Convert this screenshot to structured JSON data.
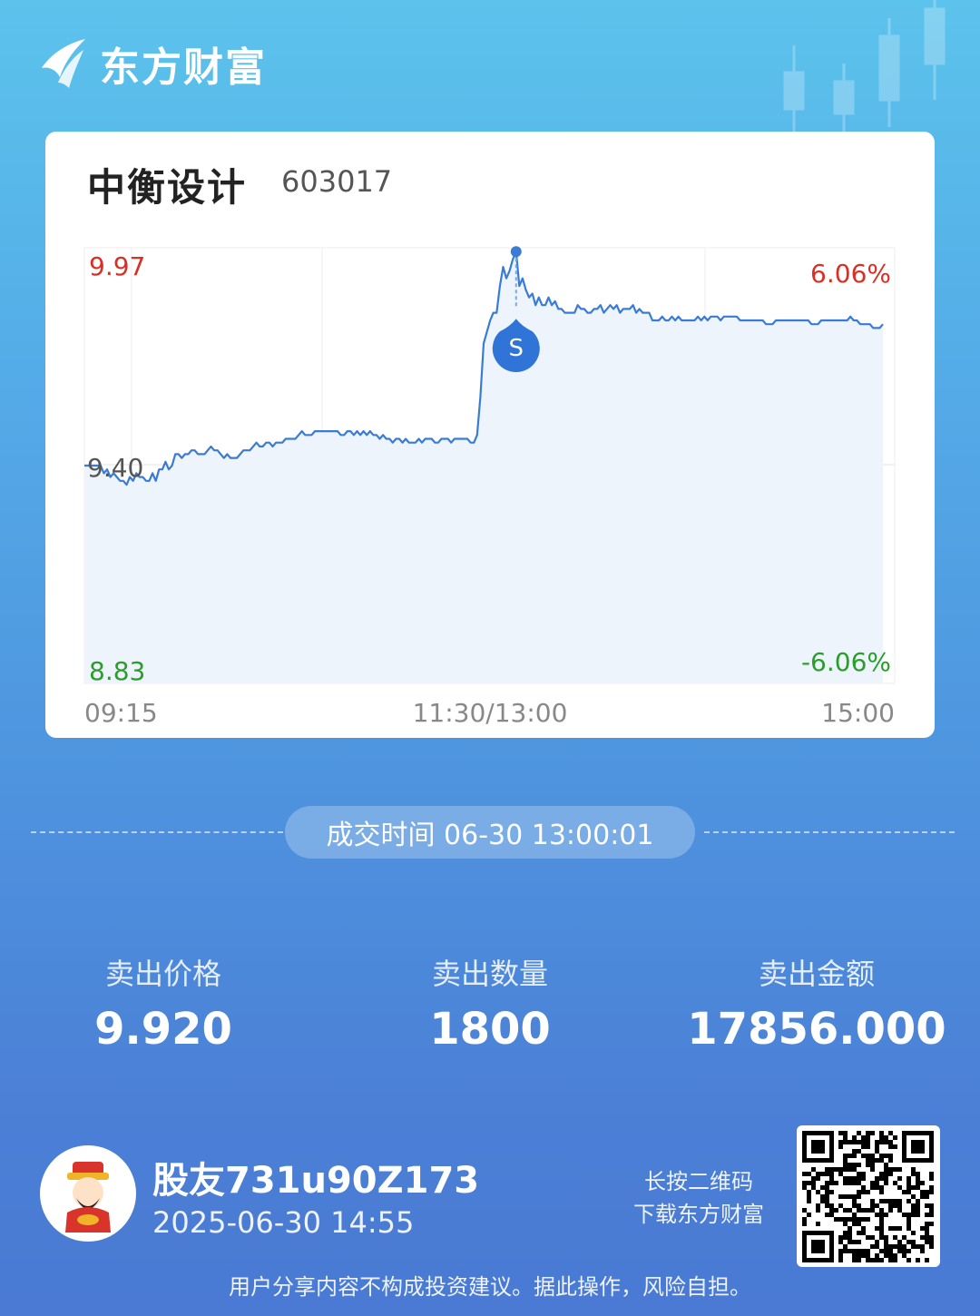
{
  "brand": {
    "name": "东方财富",
    "logo_icon": "eastmoney-logo-icon"
  },
  "stock": {
    "name": "中衡设计",
    "code": "603017"
  },
  "chart_data": {
    "type": "line",
    "x_ticks": [
      "09:15",
      "11:30/13:00",
      "15:00"
    ],
    "y_top": "9.97",
    "y_mid": "9.40",
    "y_bottom": "8.83",
    "pct_top": "6.06%",
    "pct_bottom": "-6.06%",
    "ylim": [
      8.83,
      9.97
    ],
    "ref_price": 9.4,
    "grid": true,
    "colors": {
      "line": "#3a7bd5",
      "up": "#d93026",
      "down": "#2a9d2a",
      "fill": "#eef4fc"
    },
    "marker": {
      "label": "S",
      "price": 9.92,
      "time": "13:00"
    },
    "series": [
      {
        "values": [
          9.4,
          9.4,
          9.4,
          9.4,
          9.4,
          9.4,
          9.38,
          9.39,
          9.37,
          9.38,
          9.37,
          9.36,
          9.36,
          9.35,
          9.37,
          9.36,
          9.38,
          9.37,
          9.37,
          9.36,
          9.36,
          9.38,
          9.36,
          9.39,
          9.39,
          9.41,
          9.39,
          9.4,
          9.43,
          9.43,
          9.42,
          9.43,
          9.43,
          9.44,
          9.44,
          9.43,
          9.43,
          9.43,
          9.44,
          9.45,
          9.44,
          9.44,
          9.43,
          9.42,
          9.43,
          9.42,
          9.42,
          9.42,
          9.43,
          9.44,
          9.44,
          9.44,
          9.45,
          9.46,
          9.45,
          9.45,
          9.46,
          9.46,
          9.45,
          9.46,
          9.46,
          9.46,
          9.47,
          9.47,
          9.47,
          9.47,
          9.48,
          9.49,
          9.48,
          9.48,
          9.48,
          9.49,
          9.49,
          9.49,
          9.49,
          9.49,
          9.49,
          9.49,
          9.49,
          9.48,
          9.48,
          9.49,
          9.49,
          9.48,
          9.49,
          9.48,
          9.49,
          9.48,
          9.49,
          9.48,
          9.48,
          9.47,
          9.48,
          9.47,
          9.47,
          9.46,
          9.47,
          9.47,
          9.46,
          9.47,
          9.46,
          9.46,
          9.46,
          9.47,
          9.46,
          9.47,
          9.47,
          9.47,
          9.46,
          9.46,
          9.47,
          9.47,
          9.47,
          9.46,
          9.47,
          9.47,
          9.47,
          9.47,
          9.47,
          9.46,
          9.46,
          9.48,
          9.58,
          9.72,
          9.75,
          9.78,
          9.8,
          9.8,
          9.87,
          9.92,
          9.89,
          9.91,
          9.94,
          9.96,
          9.87,
          9.89,
          9.86,
          9.84,
          9.85,
          9.82,
          9.84,
          9.82,
          9.82,
          9.84,
          9.82,
          9.83,
          9.81,
          9.81,
          9.8,
          9.8,
          9.8,
          9.8,
          9.82,
          9.81,
          9.81,
          9.8,
          9.8,
          9.81,
          9.81,
          9.82,
          9.8,
          9.81,
          9.82,
          9.81,
          9.82,
          9.8,
          9.81,
          9.81,
          9.81,
          9.82,
          9.8,
          9.81,
          9.8,
          9.8,
          9.8,
          9.78,
          9.78,
          9.78,
          9.79,
          9.78,
          9.78,
          9.79,
          9.78,
          9.79,
          9.78,
          9.78,
          9.78,
          9.78,
          9.78,
          9.79,
          9.78,
          9.79,
          9.78,
          9.79,
          9.79,
          9.79,
          9.78,
          9.79,
          9.79,
          9.79,
          9.79,
          9.79,
          9.78,
          9.78,
          9.78,
          9.78,
          9.78,
          9.78,
          9.78,
          9.78,
          9.77,
          9.77,
          9.77,
          9.78,
          9.78,
          9.78,
          9.78,
          9.78,
          9.78,
          9.78,
          9.78,
          9.78,
          9.78,
          9.78,
          9.77,
          9.77,
          9.77,
          9.78,
          9.78,
          9.78,
          9.78,
          9.78,
          9.78,
          9.78,
          9.78,
          9.78,
          9.79,
          9.78,
          9.78,
          9.77,
          9.77,
          9.77,
          9.77,
          9.76,
          9.76,
          9.76,
          9.77
        ]
      }
    ]
  },
  "trade": {
    "time_label": "成交时间 06-30 13:00:01",
    "stats": [
      {
        "label": "卖出价格",
        "value": "9.920"
      },
      {
        "label": "卖出数量",
        "value": "1800"
      },
      {
        "label": "卖出金额",
        "value": "17856.000"
      }
    ]
  },
  "user": {
    "name": "股友731u90Z173",
    "time": "2025-06-30 14:55",
    "avatar_icon": "god-of-wealth-avatar-icon"
  },
  "qr": {
    "hint_line1": "长按二维码",
    "hint_line2": "下载东方财富",
    "icon": "qr-code-icon"
  },
  "disclaimer": "用户分享内容不构成投资建议。据此操作，风险自担。"
}
